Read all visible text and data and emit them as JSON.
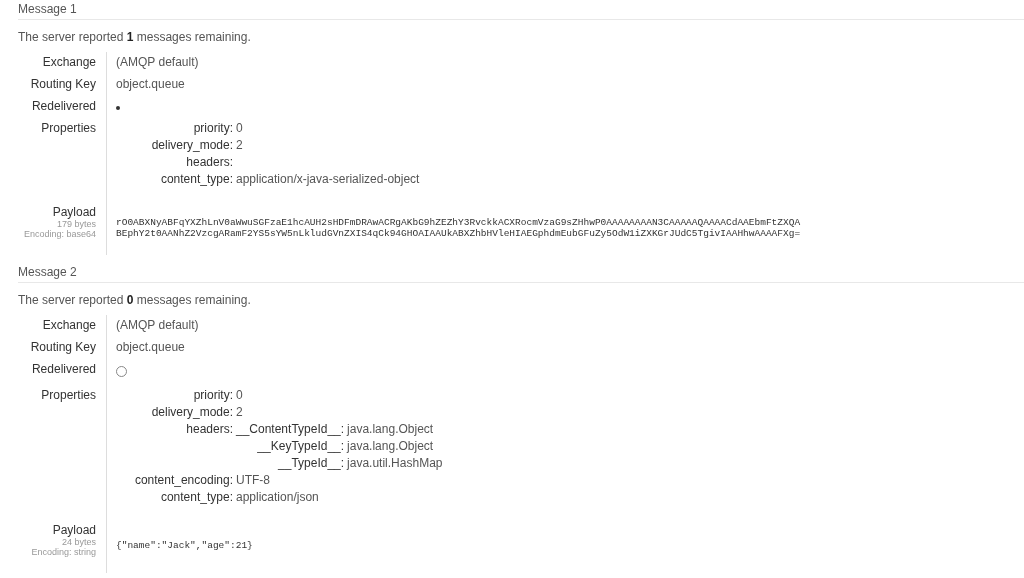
{
  "messages": [
    {
      "title": "Message 1",
      "summary": "The server reported **1** messages remaining.",
      "exchange_label": "Exchange",
      "exchange": "(AMQP default)",
      "routing_key_label": "Routing Key",
      "routing_key": "object.queue",
      "redelivered_label": "Redelivered",
      "redelivered": true,
      "properties_label": "Properties",
      "properties": [
        {
          "key": "priority:",
          "value": "0"
        },
        {
          "key": "delivery_mode:",
          "value": "2"
        },
        {
          "key": "headers:"
        },
        {
          "key": "content_type:",
          "value": "application/x-java-serialized-object"
        }
      ],
      "payload_label": "Payload",
      "payload_size": "179 bytes",
      "payload_encoding": "Encoding: base64",
      "payload_lines": [
        "rO0ABXNyABFqYXZhLnV0aWwuSGFzaE1hcAUH2sHDFmDRAwACRgAKbG9hZEZhY3RvckkACXRocmVzaG9sZHhwP0AAAAAAAAN3CAAAAAQAAAACdAAEbmFtZXQA",
        "BEphY2t0AANhZ2VzcgARamF2YS5sYW5nLkludGVnZXIS4qCk94GHOAIAAUkABXZhbHVleHIAEGphdmEubGFuZy5OdW1iZXKGrJUdC5TgivIAAHhwAAAAFXg="
      ]
    },
    {
      "title": "Message 2",
      "summary": "The server reported **0** messages remaining.",
      "exchange_label": "Exchange",
      "exchange": "(AMQP default)",
      "routing_key_label": "Routing Key",
      "routing_key": "object.queue",
      "redelivered_label": "Redelivered",
      "redelivered": false,
      "properties_label": "Properties",
      "properties": [
        {
          "key": "priority:",
          "value": "0"
        },
        {
          "key": "delivery_mode:",
          "value": "2"
        },
        {
          "key": "headers:",
          "headers": [
            {
              "key": "__ContentTypeId__:",
              "value": "java.lang.Object"
            },
            {
              "key": "__KeyTypeId__:",
              "value": "java.lang.Object"
            },
            {
              "key": "__TypeId__:",
              "value": "java.util.HashMap"
            }
          ]
        },
        {
          "key": "content_encoding:",
          "value": "UTF-8"
        },
        {
          "key": "content_type:",
          "value": "application/json"
        }
      ],
      "payload_label": "Payload",
      "payload_size": "24 bytes",
      "payload_encoding": "Encoding: string",
      "payload_lines": [
        "{\"name\":\"Jack\",\"age\":21}"
      ]
    }
  ]
}
